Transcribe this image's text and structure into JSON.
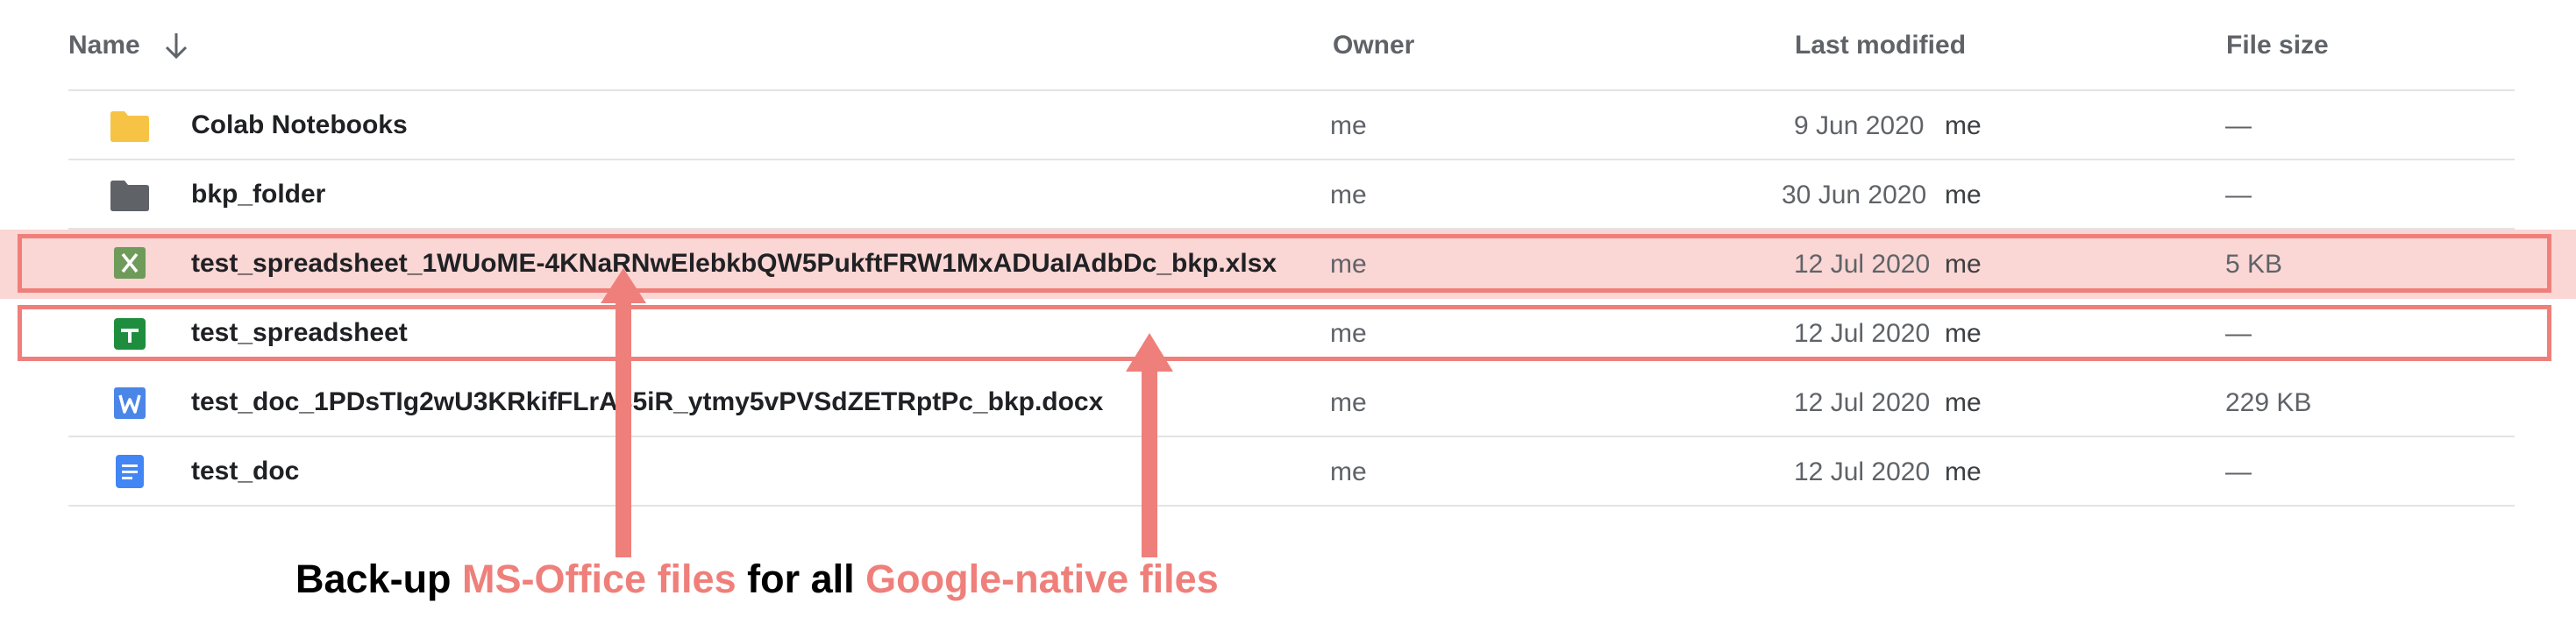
{
  "columns": {
    "name": "Name",
    "owner": "Owner",
    "last_modified": "Last modified",
    "file_size": "File size"
  },
  "sort_icon": "arrow-down-icon",
  "rows": [
    {
      "name": "Colab Notebooks",
      "icon": "folder-yellow-icon",
      "owner": "me",
      "modified_date": "9 Jun 2020",
      "modified_by": "me",
      "size": "—"
    },
    {
      "name": "bkp_folder",
      "icon": "folder-gray-icon",
      "owner": "me",
      "modified_date": "30 Jun 2020",
      "modified_by": "me",
      "size": "—"
    },
    {
      "name": "test_spreadsheet_1WUoME-4KNaRNwElebkbQW5PukftFRW1MxADUaIAdbDc_bkp.xlsx",
      "icon": "excel-file-icon",
      "owner": "me",
      "modified_date": "12 Jul 2020",
      "modified_by": "me",
      "size": "5 KB"
    },
    {
      "name": "test_spreadsheet",
      "icon": "google-sheets-icon",
      "owner": "me",
      "modified_date": "12 Jul 2020",
      "modified_by": "me",
      "size": "—"
    },
    {
      "name": "test_doc_1PDsTIg2wU3KRkifFLrA35iR_ytmy5vPVSdZETRptPc_bkp.docx",
      "icon": "word-file-icon",
      "owner": "me",
      "modified_date": "12 Jul 2020",
      "modified_by": "me",
      "size": "229 KB"
    },
    {
      "name": "test_doc",
      "icon": "google-docs-icon",
      "owner": "me",
      "modified_date": "12 Jul 2020",
      "modified_by": "me",
      "size": "—"
    }
  ],
  "annotation": {
    "part1": "Back-up ",
    "part2": "MS-Office files",
    "part3": " for all ",
    "part4": "Google-native files",
    "accent_color": "#ef7f7a"
  },
  "colors": {
    "folder_yellow": "#f6c344",
    "folder_gray": "#5f6368",
    "excel_green": "#6f9b5a",
    "sheets_green": "#1e8e3e",
    "word_blue": "#4a86e8",
    "docs_blue": "#4285f4"
  }
}
